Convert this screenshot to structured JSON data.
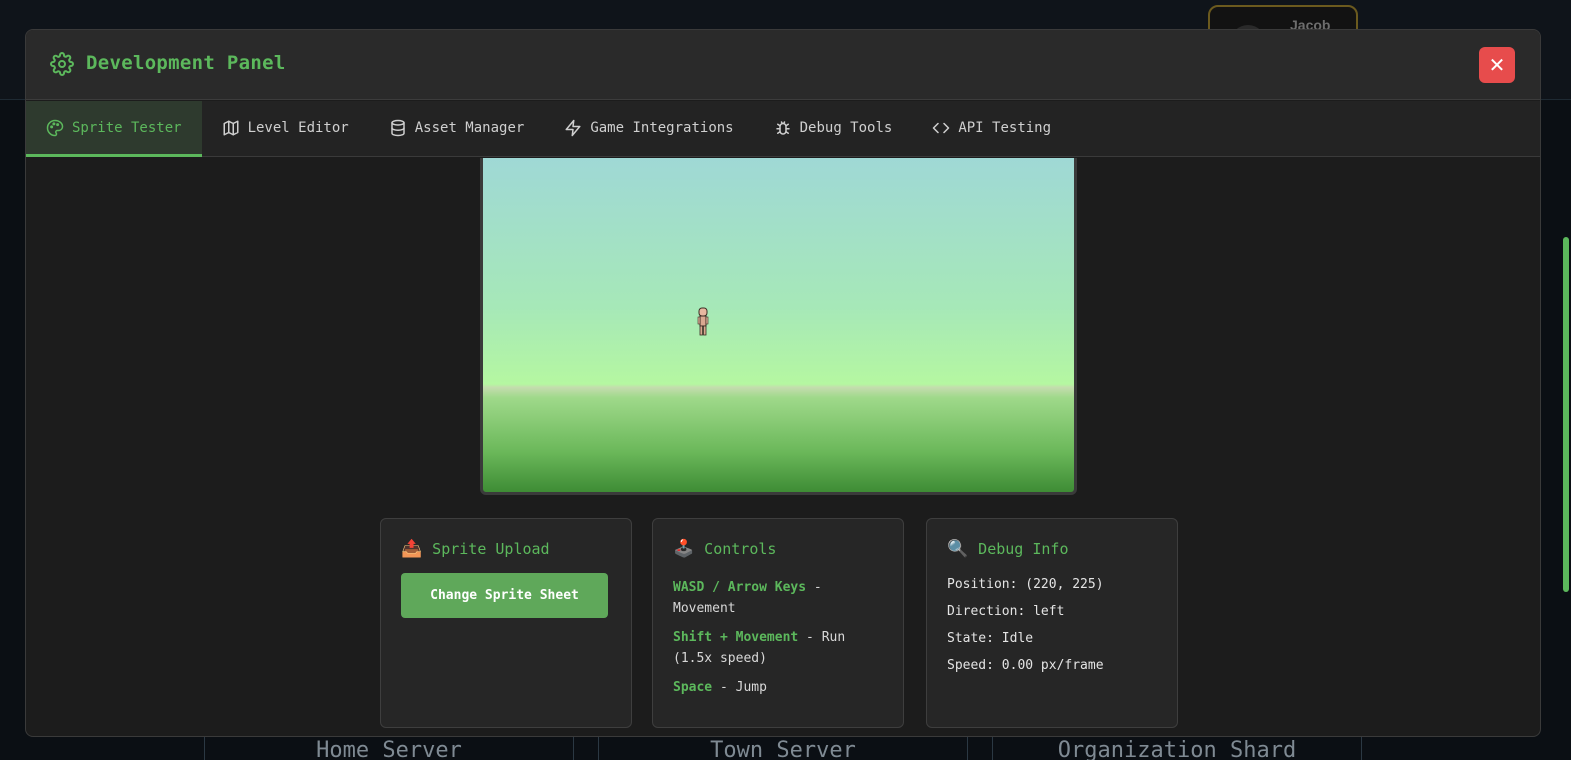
{
  "background": {
    "user_name": "Jacob",
    "servers": [
      "Home Server",
      "Town Server",
      "Organization Shard"
    ]
  },
  "modal": {
    "title": "Development Panel",
    "close_label": "✕"
  },
  "tabs": [
    {
      "label": "Sprite Tester",
      "icon": "palette-icon",
      "active": true
    },
    {
      "label": "Level Editor",
      "icon": "map-icon",
      "active": false
    },
    {
      "label": "Asset Manager",
      "icon": "database-icon",
      "active": false
    },
    {
      "label": "Game Integrations",
      "icon": "lightning-icon",
      "active": false
    },
    {
      "label": "Debug Tools",
      "icon": "bug-icon",
      "active": false
    },
    {
      "label": "API Testing",
      "icon": "code-icon",
      "active": false
    }
  ],
  "sprite_upload": {
    "icon": "📤",
    "title": "Sprite Upload",
    "button_label": "Change Sprite Sheet"
  },
  "controls": {
    "icon": "🕹️",
    "title": "Controls",
    "items": [
      {
        "key": "WASD / Arrow Keys",
        "desc": " - Movement"
      },
      {
        "key": "Shift + Movement",
        "desc": " - Run (1.5x speed)"
      },
      {
        "key": "Space",
        "desc": " - Jump"
      }
    ]
  },
  "debug_info": {
    "icon": "🔍",
    "title": "Debug Info",
    "position": "Position: (220, 225)",
    "direction": "Direction: left",
    "state": "State: Idle",
    "speed": "Speed: 0.00 px/frame"
  },
  "colors": {
    "accent": "#5cb85c",
    "close": "#e74c4c",
    "panel_bg": "#262626"
  }
}
